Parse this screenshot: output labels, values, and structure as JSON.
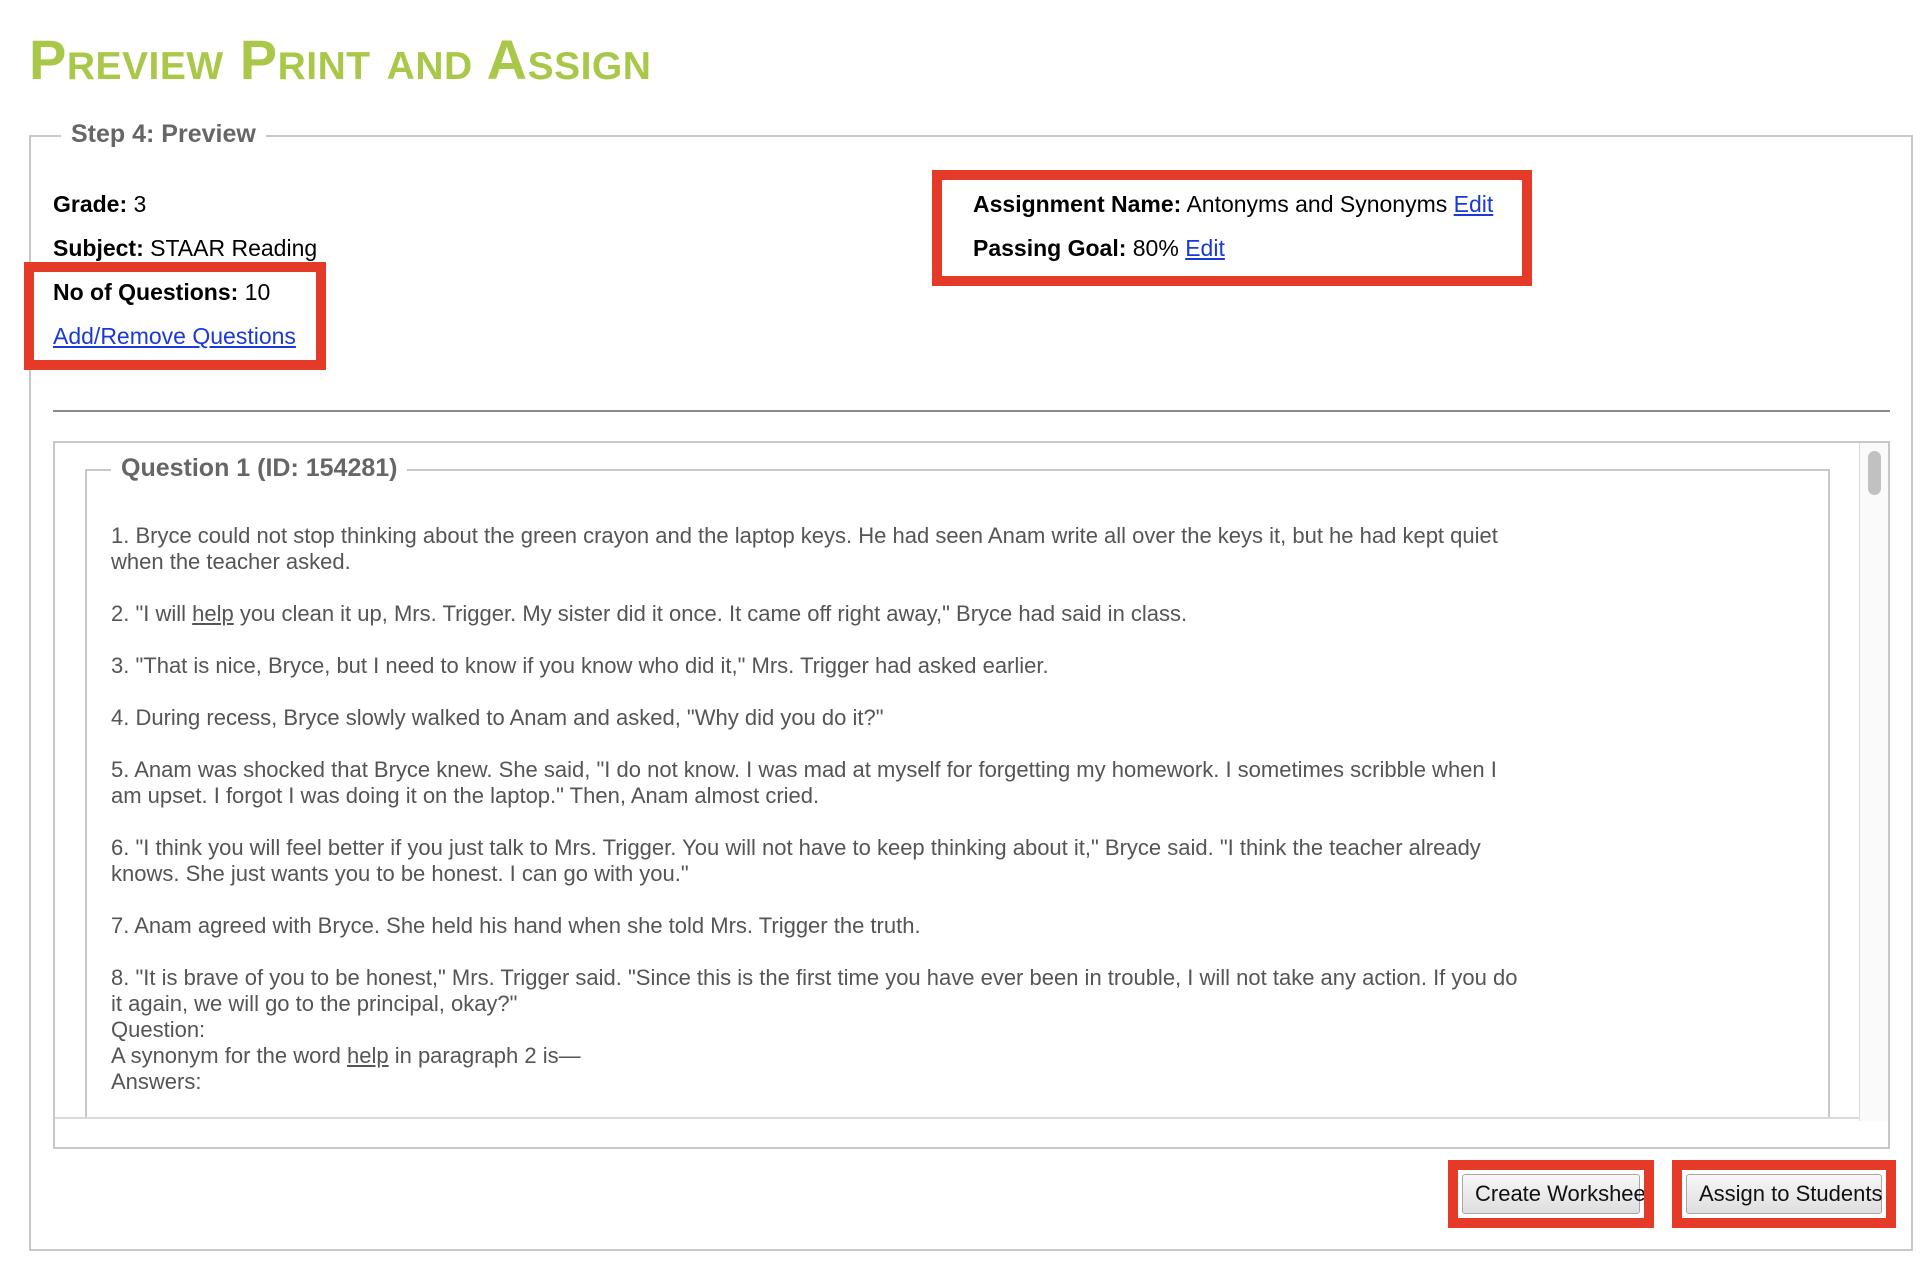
{
  "page": {
    "title": "Preview Print and Assign"
  },
  "step": {
    "legend": "Step 4: Preview"
  },
  "details": {
    "grade": {
      "label": "Grade:",
      "value": "3"
    },
    "subject": {
      "label": "Subject:",
      "value": "STAAR Reading"
    },
    "num_questions": {
      "label": "No of Questions:",
      "value": "10"
    },
    "add_remove_link": "Add/Remove Questions",
    "assignment_name": {
      "label": "Assignment Name:",
      "value": "Antonyms and Synonyms",
      "edit": "Edit"
    },
    "passing_goal": {
      "label": "Passing Goal:",
      "value": "80%",
      "edit": "Edit"
    }
  },
  "question": {
    "legend": "Question 1 (ID: 154281)",
    "paragraphs": [
      "1. Bryce could not stop thinking about the green crayon and the laptop keys. He had seen Anam write all over the keys it, but he had kept quiet when the teacher asked.",
      {
        "before": "2. \"I will ",
        "underlined": "help",
        "after": " you clean it up, Mrs. Trigger. My sister did it once. It came off right away,\" Bryce had said in class."
      },
      "3. \"That is nice, Bryce, but I need to know if you know who did it,\" Mrs. Trigger had asked earlier.",
      "4. During recess, Bryce slowly walked to Anam and asked, \"Why did you do it?\"",
      "5. Anam was shocked that Bryce knew. She said, \"I do not know. I was mad at myself for forgetting my homework. I sometimes scribble when I am upset. I forgot I was doing it on the laptop.\" Then, Anam almost cried.",
      "6. \"I think you will feel better if you just talk to Mrs. Trigger. You will not have to keep thinking about it,\" Bryce said. \"I think the teacher already knows. She just wants you to be honest. I can go with you.\"",
      "7. Anam agreed with Bryce. She held his hand when she told Mrs. Trigger the truth.",
      "8. \"It is brave of you to be honest,\" Mrs. Trigger said. \"Since this is the first time you have ever been in trouble, I will not take any action. If you do it again, we will go to the principal, okay?\""
    ],
    "question_label": "Question:",
    "prompt": {
      "before": "A synonym for the word ",
      "underlined": "help",
      "after": " in paragraph 2 is—"
    },
    "answers_label": "Answers:"
  },
  "buttons": {
    "create_worksheet": "Create Worksheet",
    "assign_students": "Assign to Students"
  },
  "colors": {
    "title": "#a9c84a",
    "highlight": "#e53a27",
    "link": "#1a39d8",
    "answer_dot": "#6cc24a"
  }
}
